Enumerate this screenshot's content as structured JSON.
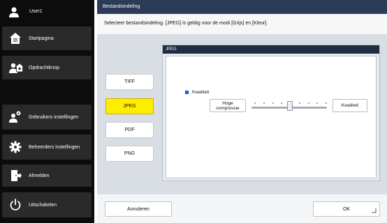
{
  "sidebar": {
    "user": {
      "label": "User1",
      "icon": "user-icon"
    },
    "items": [
      {
        "label": "Startpagina",
        "icon": "home-icon"
      },
      {
        "label": "Opdrachtknop",
        "icon": "command-icon"
      },
      {
        "label": "Gebruikers instellingen",
        "icon": "user-settings-icon"
      },
      {
        "label": "Beheerders instellingen",
        "icon": "gear-icon"
      },
      {
        "label": "Afmelden",
        "icon": "logout-icon"
      },
      {
        "label": "Uitschakelen",
        "icon": "power-icon"
      }
    ]
  },
  "header": {
    "title": "Bestandsindeling"
  },
  "instruction": "Selecteer bestandsindeling. [JPEG] is geldig voor de modi [Grijs] en [Kleur].",
  "formats": {
    "selected": "JPEG",
    "items": [
      "TIFF",
      "JPEG",
      "PDF",
      "PNG"
    ]
  },
  "jpeg_panel": {
    "title": "JPEG",
    "quality_label": "Kwaliteit",
    "high_compression_label": "Hoge\ncompressie",
    "quality_button_label": "Kwaliteit",
    "slider_position_fraction": 0.5,
    "slider_steps": 9
  },
  "footer": {
    "cancel_label": "Annuleren",
    "ok_label": "OK"
  },
  "colors": {
    "accent_yellow": "#ffed00",
    "title_bar": "#2c3b57",
    "bullet_blue": "#1f5ad2"
  }
}
